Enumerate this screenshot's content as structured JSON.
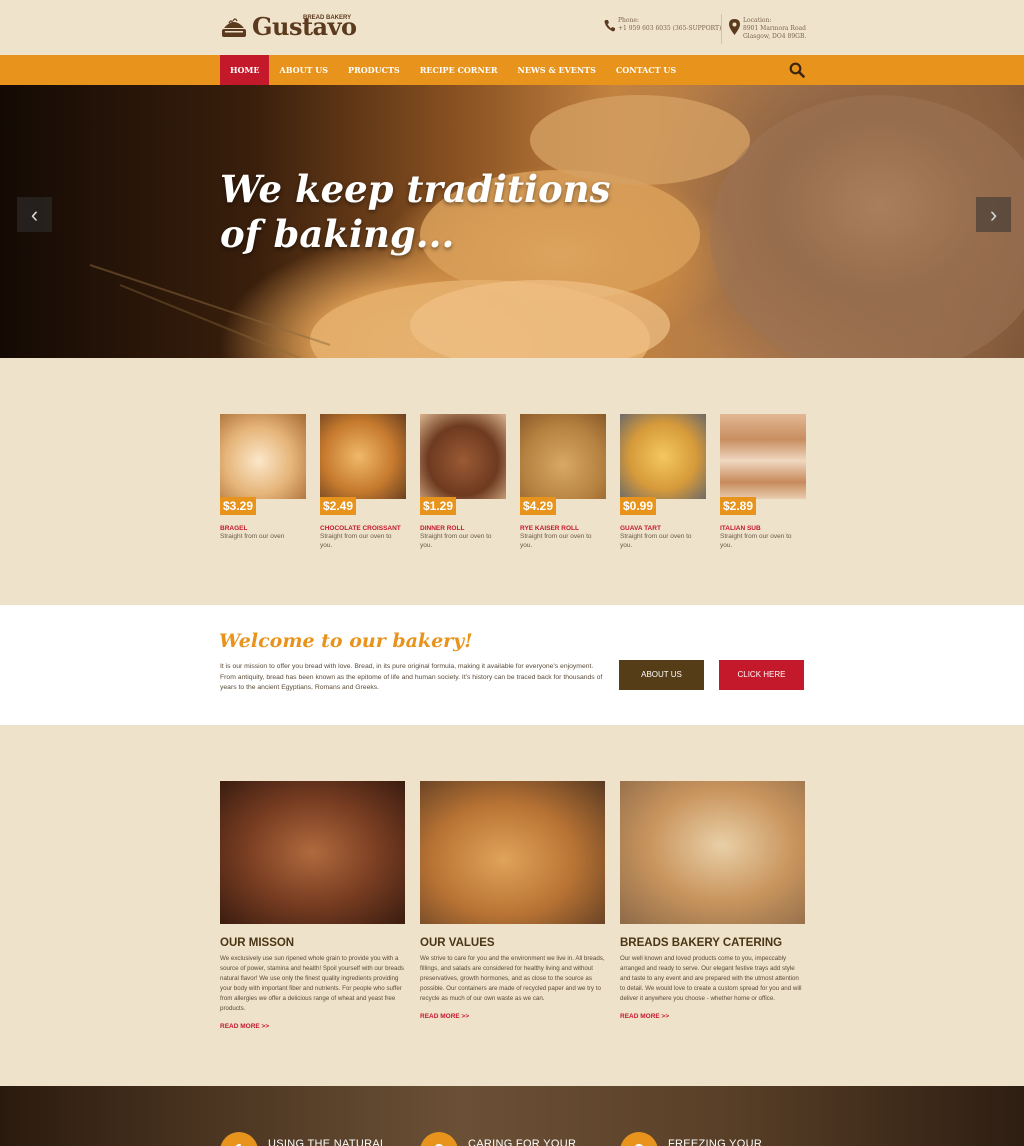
{
  "header": {
    "logo_text": "Gustavo",
    "logo_tagline": "BREAD BAKERY",
    "phone_label": "Phone:",
    "phone_value": "+1 959 603 6035 (365-SUPPORT)",
    "location_label": "Location:",
    "location_line1": "8901 Marmora Road",
    "location_line2": "Glasgow, DO4 89GB."
  },
  "nav": {
    "items": [
      "HOME",
      "ABOUT US",
      "PRODUCTS",
      "RECIPE CORNER",
      "NEWS & EVENTS",
      "CONTACT US"
    ],
    "active_index": 0,
    "search_icon": "search-icon"
  },
  "hero": {
    "title_line1": "We keep traditions",
    "title_line2": "of baking...",
    "prev_arrow": "‹",
    "next_arrow": "›"
  },
  "products": [
    {
      "price": "$3.29",
      "name": "BRAGEL",
      "desc": "Straight from our oven"
    },
    {
      "price": "$2.49",
      "name": "CHOCOLATE CROISSANT",
      "desc": "Straight from our oven to you."
    },
    {
      "price": "$1.29",
      "name": "DINNER ROLL",
      "desc": "Straight from our oven to you."
    },
    {
      "price": "$4.29",
      "name": "RYE KAISER ROLL",
      "desc": "Straight from our oven to you."
    },
    {
      "price": "$0.99",
      "name": "GUAVA TART",
      "desc": "Straight from our oven to you."
    },
    {
      "price": "$2.89",
      "name": "ITALIAN SUB",
      "desc": "Straight from our oven to you."
    }
  ],
  "welcome": {
    "title": "Welcome to our bakery!",
    "text": "It is our mission to offer you bread with love. Bread, in its pure original formula, making it available for everyone's enjoyment. From antiquity, bread has been known as the epitome of life and human society. It's history can be traced back for thousands of years to the ancient Egyptians, Romans and Greeks.",
    "about_button": "ABOUT US",
    "click_button": "CLICK HERE"
  },
  "features": [
    {
      "title": "OUR MISSON",
      "text": "We exclusively use sun ripened whole grain to provide you with a source of power, stamina and health! Spoil yourself with our breads natural flavor! We use only the finest quality ingredients providing your body with important fiber and nutrients. For people who suffer from allergies we offer a delicious range of wheat and yeast free products.",
      "more": "READ MORE >>"
    },
    {
      "title": "OUR VALUES",
      "text": "We strive to care for you and the environment we live in. All breads, fillings, and salads are considered for healthy living and without preservatives, growth hormones, and as close to the source as possible. Our containers are made of recycled paper and we try to recycle as much of our own waste as we can.",
      "more": "READ MORE >>"
    },
    {
      "title": "BREADS BAKERY CATERING",
      "text": "Our well known and loved products come to you, impeccably arranged and ready to serve. Our elegant festive trays add style and taste to any event and are prepared with the utmost attention to detail. We would love to create a custom spread for you and will deliver it anywhere you choose - whether home or office.",
      "more": "READ MORE >>"
    }
  ],
  "band": [
    {
      "num": "1",
      "text": "USING THE NATURAL"
    },
    {
      "num": "2",
      "text": "CARING FOR YOUR"
    },
    {
      "num": "3",
      "text": "FREEZING YOUR"
    }
  ],
  "colors": {
    "accent_orange": "#e8941c",
    "accent_red": "#c4182b",
    "brown_button": "#553d17",
    "background": "#efe2cb"
  }
}
